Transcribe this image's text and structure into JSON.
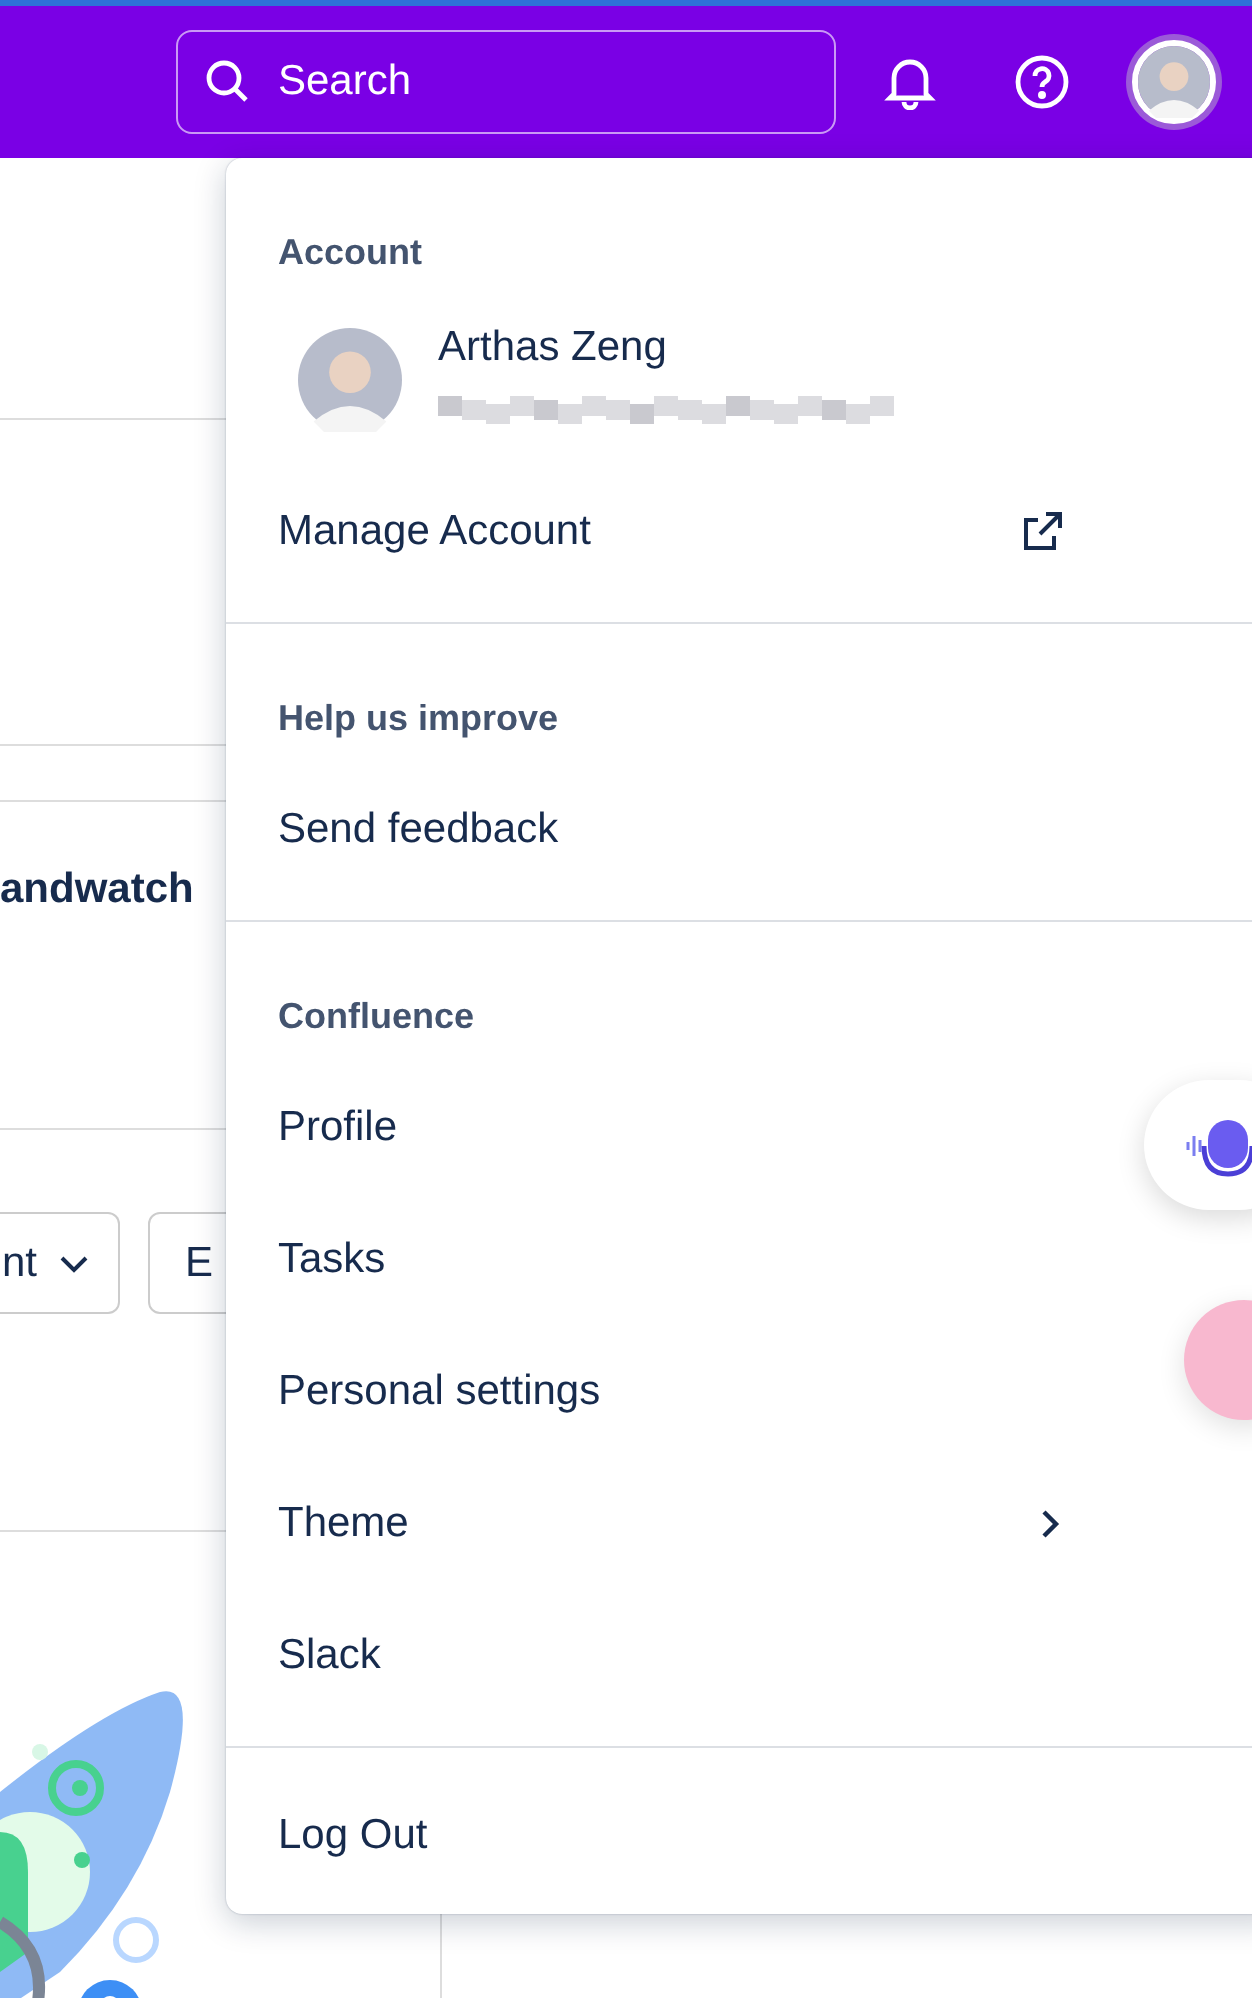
{
  "top_bar": {
    "search": {
      "placeholder": "Search"
    }
  },
  "background": {
    "heading": "andwatch",
    "filters": [
      {
        "label": "nt",
        "kind": "dropdown"
      },
      {
        "label": "E",
        "kind": "plain"
      }
    ]
  },
  "menu": {
    "sections": [
      {
        "title": "Account",
        "account": {
          "name": "Arthas Zeng"
        },
        "items": [
          {
            "label": "Manage Account",
            "kind": "external"
          }
        ]
      },
      {
        "title": "Help us improve",
        "items": [
          {
            "label": "Send feedback",
            "kind": "plain"
          }
        ]
      },
      {
        "title": "Confluence",
        "items": [
          {
            "label": "Profile",
            "kind": "plain"
          },
          {
            "label": "Tasks",
            "kind": "plain"
          },
          {
            "label": "Personal settings",
            "kind": "plain"
          },
          {
            "label": "Theme",
            "kind": "submenu"
          },
          {
            "label": "Slack",
            "kind": "plain"
          }
        ]
      },
      {
        "items": [
          {
            "label": "Log Out",
            "kind": "plain"
          }
        ]
      }
    ]
  }
}
